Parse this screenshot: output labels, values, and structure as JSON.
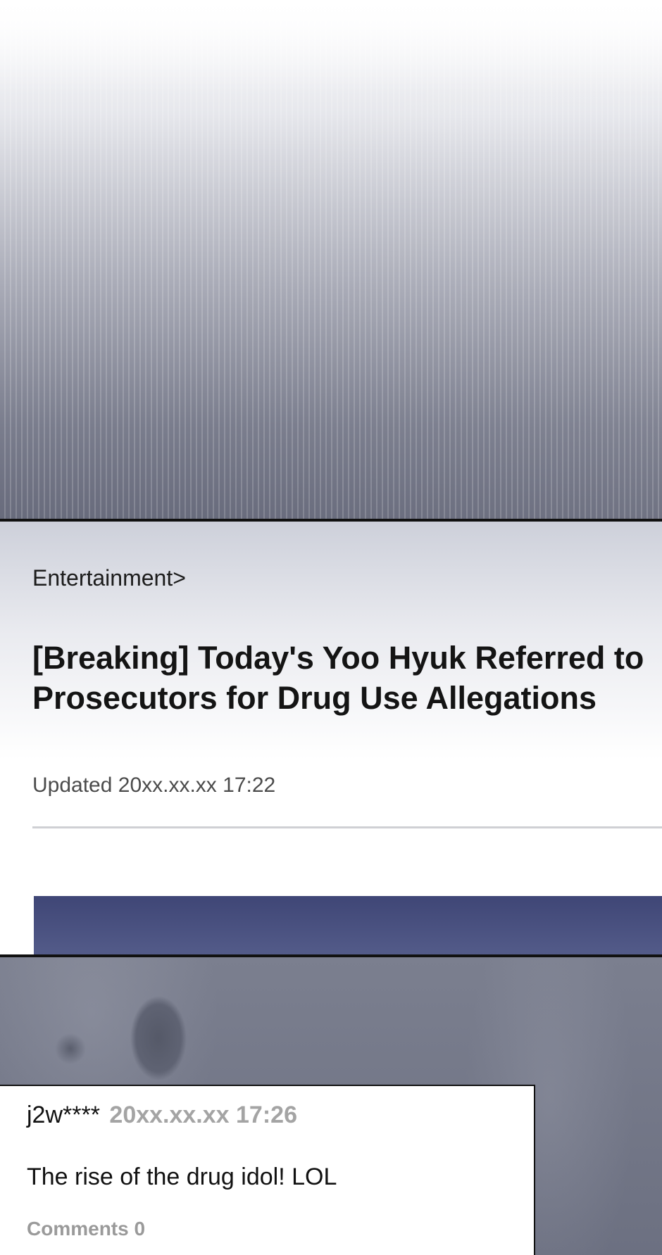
{
  "article": {
    "category": "Entertainment>",
    "headline_line1": "[Breaking] Today's Yoo Hyuk Referred to",
    "headline_line2": "Prosecutors for Drug Use Allegations",
    "updated": "Updated 20xx.xx.xx 17:22"
  },
  "comment": {
    "user": "j2w****",
    "time": "20xx.xx.xx 17:26",
    "text": "The rise of the drug idol! LOL",
    "count_label": "Comments 0"
  },
  "colors": {
    "border": "#111111",
    "image_strip": "#4a5180",
    "muted_text": "#a4a4a4"
  }
}
